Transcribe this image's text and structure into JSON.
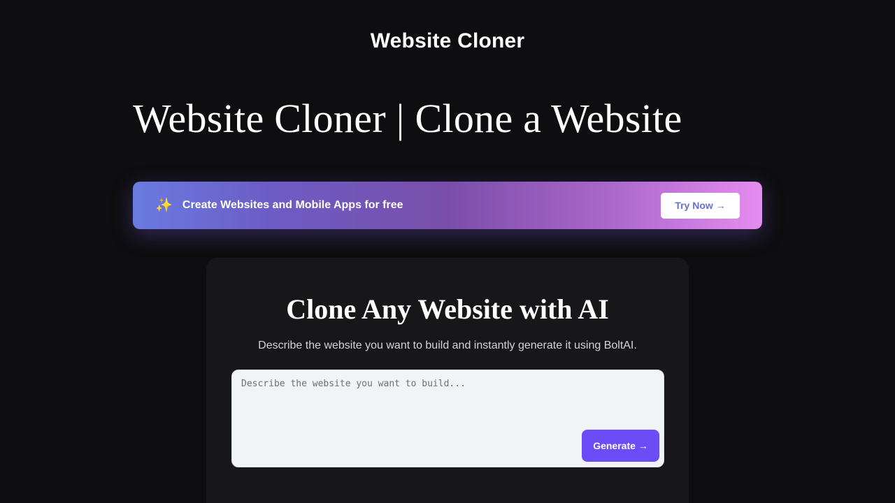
{
  "header": {
    "site_title": "Website Cloner"
  },
  "hero": {
    "title": "Website Cloner | Clone a Website"
  },
  "promo": {
    "icon": "sparkle-icon",
    "icon_glyph": "✨",
    "text": "Create Websites and Mobile Apps for free",
    "button_label": "Try Now →",
    "gradient_colors": [
      "#6a7be0",
      "#7a4eaa",
      "#e68cf0"
    ]
  },
  "clone_card": {
    "title": "Clone Any Website with AI",
    "subtitle": "Describe the website you want to build and instantly generate it using BoltAI.",
    "input_value": "",
    "input_placeholder": "Describe the website you want to build...",
    "generate_label": "Generate →",
    "generate_color": "#6b4cf6"
  },
  "colors": {
    "background": "#0e0e10",
    "card_background": "#17171a"
  }
}
